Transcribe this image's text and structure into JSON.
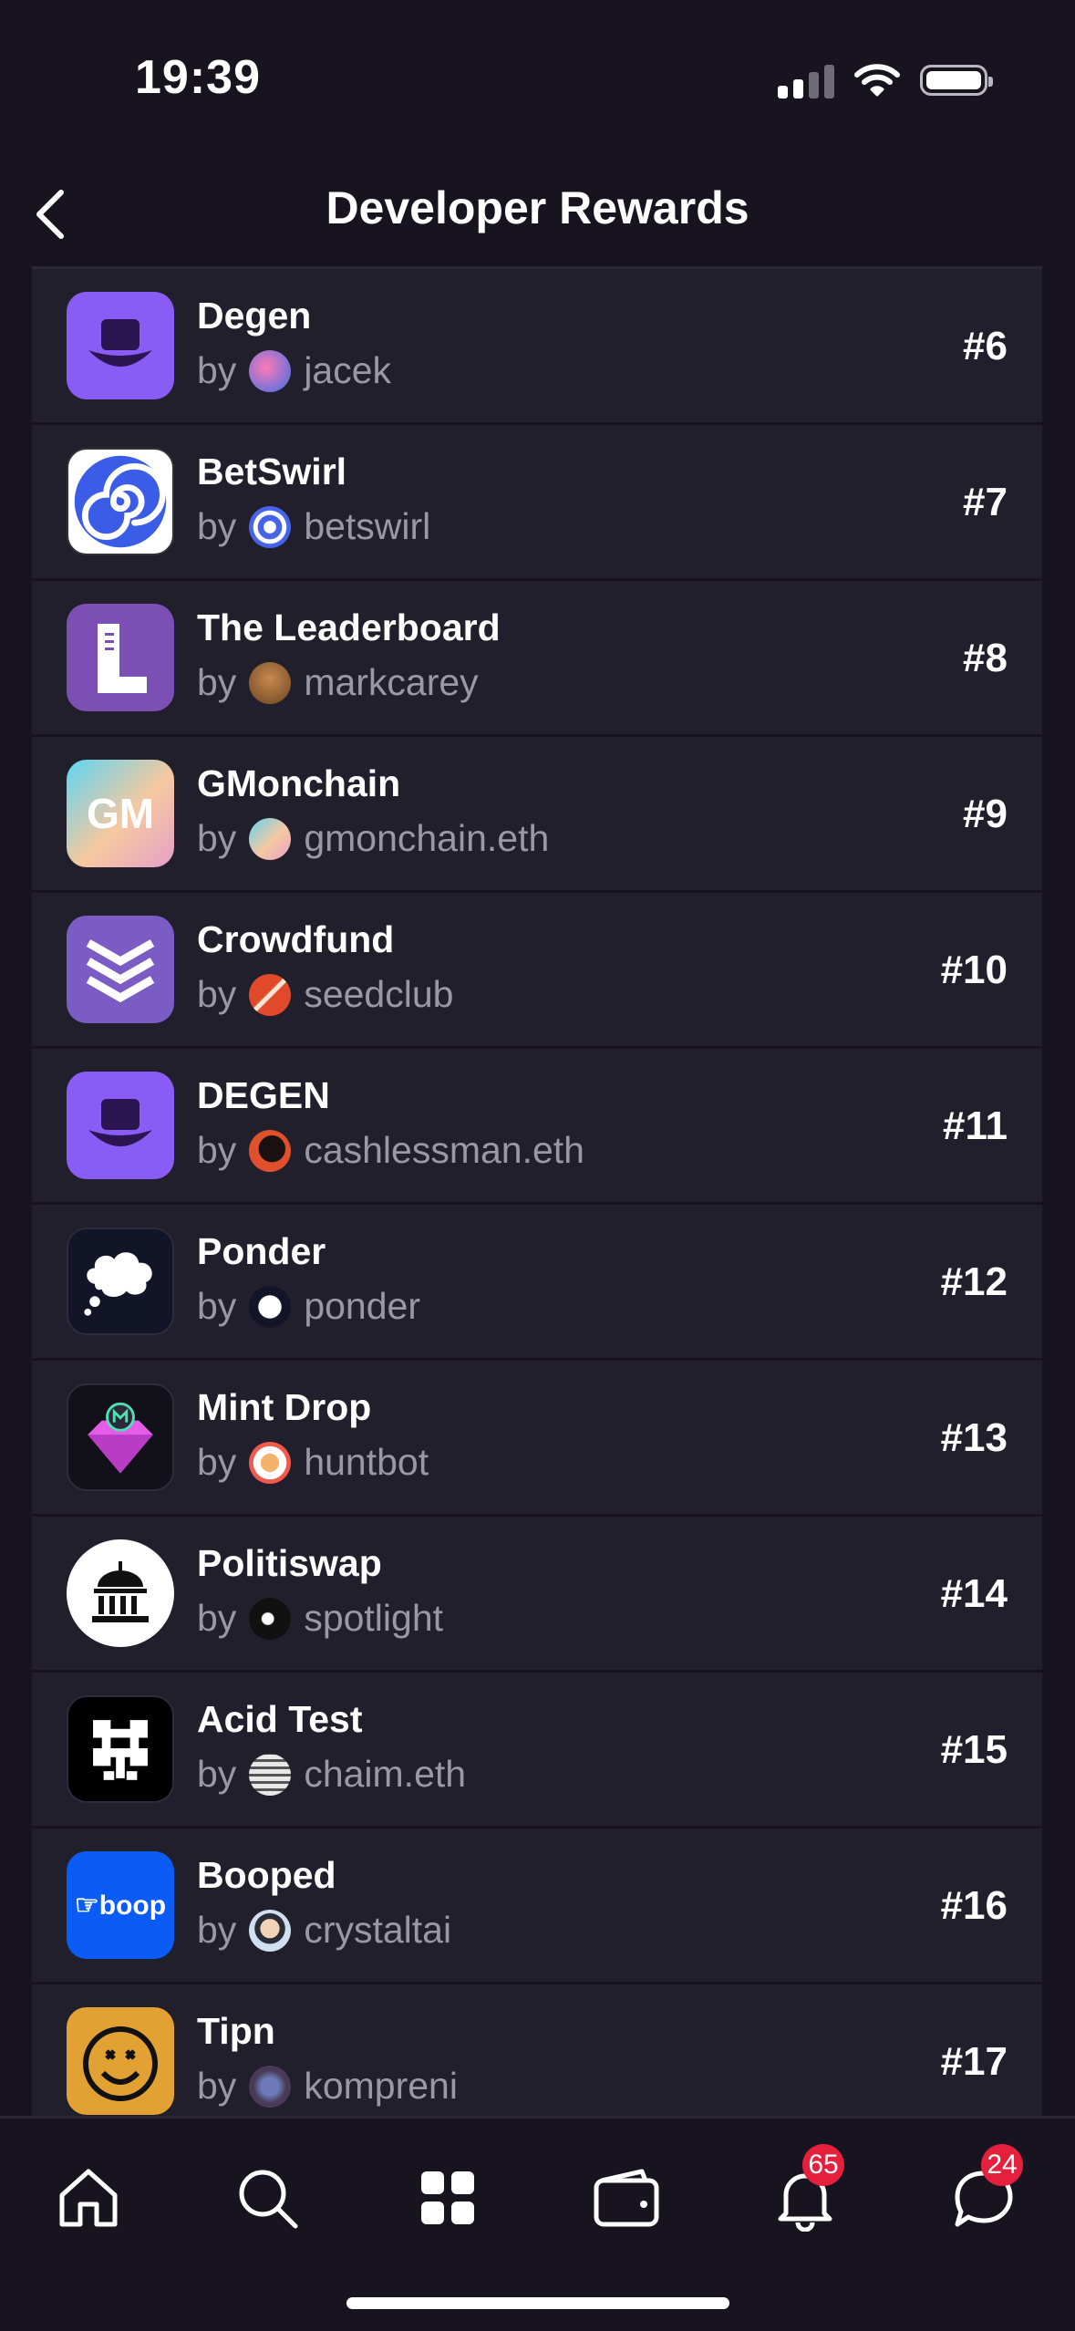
{
  "status_bar": {
    "time": "19:39"
  },
  "header": {
    "title": "Developer Rewards"
  },
  "by_word": "by",
  "apps": [
    {
      "name": "Degen",
      "author": "jacek",
      "rank": "#6",
      "icon": "degen-hat-icon",
      "avatar": "jacek-avatar"
    },
    {
      "name": "BetSwirl",
      "author": "betswirl",
      "rank": "#7",
      "icon": "betswirl-swirl-icon",
      "avatar": "betswirl-avatar"
    },
    {
      "name": "The Leaderboard",
      "author": "markcarey",
      "rank": "#8",
      "icon": "leaderboard-l-icon",
      "avatar": "markcarey-avatar"
    },
    {
      "name": "GMonchain",
      "author": "gmonchain.eth",
      "rank": "#9",
      "icon": "gmonchain-icon",
      "avatar": "gmonchain-avatar"
    },
    {
      "name": "Crowdfund",
      "author": "seedclub",
      "rank": "#10",
      "icon": "crowdfund-chevrons-icon",
      "avatar": "seedclub-avatar"
    },
    {
      "name": "DEGEN",
      "author": "cashlessman.eth",
      "rank": "#11",
      "icon": "degen-hat-icon",
      "avatar": "cashlessman-avatar"
    },
    {
      "name": "Ponder",
      "author": "ponder",
      "rank": "#12",
      "icon": "ponder-cloud-icon",
      "avatar": "ponder-avatar"
    },
    {
      "name": "Mint Drop",
      "author": "huntbot",
      "rank": "#13",
      "icon": "mint-drop-gem-icon",
      "avatar": "huntbot-avatar"
    },
    {
      "name": "Politiswap",
      "author": "spotlight",
      "rank": "#14",
      "icon": "politiswap-capitol-icon",
      "avatar": "spotlight-avatar"
    },
    {
      "name": "Acid Test",
      "author": "chaim.eth",
      "rank": "#15",
      "icon": "acid-test-icon",
      "avatar": "chaim-avatar"
    },
    {
      "name": "Booped",
      "author": "crystaltai",
      "rank": "#16",
      "icon": "booped-icon",
      "avatar": "crystaltai-avatar"
    },
    {
      "name": "Tipn",
      "author": "kompreni",
      "rank": "#17",
      "icon": "tipn-smiley-icon",
      "avatar": "kompreni-avatar"
    }
  ],
  "booped_icon_text": "☞boop",
  "gm_icon_text": "GM",
  "tabs": [
    {
      "name": "home",
      "icon": "home-icon"
    },
    {
      "name": "search",
      "icon": "search-icon"
    },
    {
      "name": "apps",
      "icon": "apps-grid-icon"
    },
    {
      "name": "wallet",
      "icon": "wallet-icon"
    },
    {
      "name": "notifications",
      "icon": "bell-icon",
      "badge": "65"
    },
    {
      "name": "messages",
      "icon": "chat-icon",
      "badge": "24"
    }
  ],
  "colors": {
    "background": "#17141f",
    "row": "#221f2c",
    "muted_text": "#9b98a6",
    "badge": "#e5203c",
    "accent_purple": "#8a5cf6"
  }
}
